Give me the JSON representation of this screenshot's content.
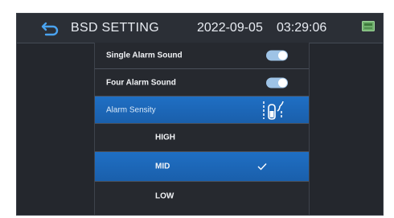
{
  "header": {
    "title": "BSD SETTING",
    "date": "2022-09-05",
    "time": "03:29:06",
    "back_icon": "back-arrow-icon",
    "storage_icon": "sd-card-icon"
  },
  "menu": {
    "single_alarm": {
      "label": "Single Alarm Sound",
      "enabled": true
    },
    "four_alarm": {
      "label": "Four Alarm Sound",
      "enabled": true
    },
    "sensitivity": {
      "label": "Alarm Sensity",
      "icon": "blind-spot-sensor-icon"
    },
    "options": [
      {
        "label": "HIGH",
        "selected": false
      },
      {
        "label": "MID",
        "selected": true
      },
      {
        "label": "LOW",
        "selected": false
      }
    ]
  },
  "colors": {
    "accent": "#1f6fc4",
    "toggle_on": "#9ec3e6",
    "background": "#24272d"
  }
}
